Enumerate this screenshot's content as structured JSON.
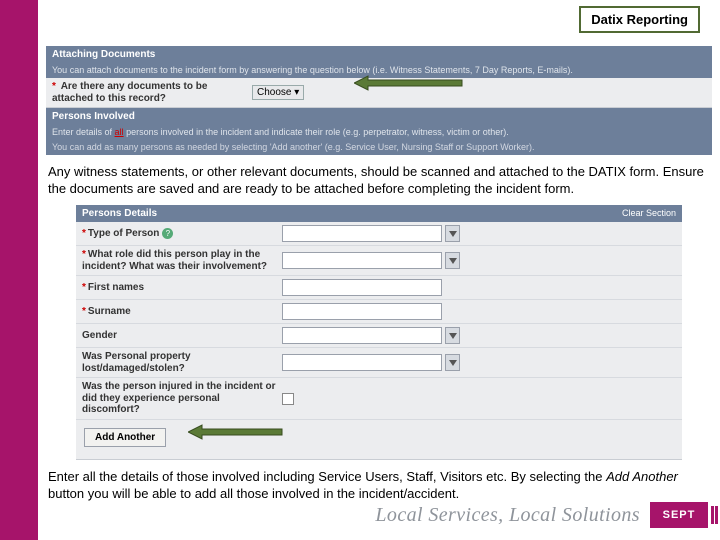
{
  "title": "Datix Reporting",
  "attaching": {
    "header": "Attaching Documents",
    "subtext": "You can attach documents to the incident form by answering the question below (i.e. Witness Statements, 7 Day Reports, E-mails).",
    "q1_label": "Are there any documents to be attached to this record?",
    "q1_choose": "Choose"
  },
  "persons_head": {
    "header": "Persons Involved",
    "line1a": "Enter details of ",
    "line1_all": "all",
    "line1b": " persons involved in the incident and indicate their role (e.g. perpetrator, witness, victim or other).",
    "line2": "You can add as many persons as needed by selecting 'Add another' (e.g. Service User, Nursing Staff or Support Worker)."
  },
  "para1": "Any witness statements, or other relevant documents, should be scanned and attached to the DATIX form. Ensure the documents are saved and are ready to be attached before completing the incident form.",
  "details": {
    "header": "Persons Details",
    "clear": "Clear Section",
    "type_label": "Type of Person",
    "role_label": "What role did this person play in the incident? What was their involvement?",
    "first_label": "First names",
    "surname_label": "Surname",
    "gender_label": "Gender",
    "property_label": "Was Personal property lost/damaged/stolen?",
    "injured_label": "Was the person injured in the incident or did they experience personal discomfort?",
    "add_btn": "Add Another"
  },
  "para2": "Enter all the details of those involved including Service Users, Staff, Visitors etc. By selecting the Add Another button you will be able to add all those involved in the incident/accident.",
  "footer_text": "Local Services, Local Solutions",
  "logo": "SEPT"
}
